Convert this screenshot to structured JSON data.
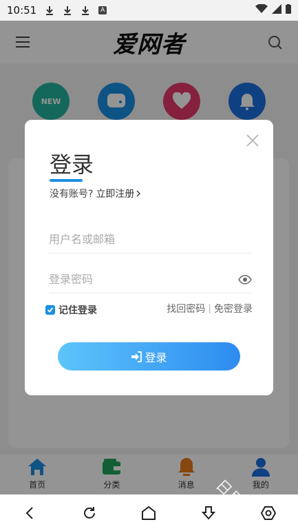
{
  "status": {
    "time": "10:51",
    "a_badge": "A"
  },
  "app": {
    "logo": "爱网者"
  },
  "shortcuts": [
    {
      "label": "NEW",
      "color": "#23b39d"
    },
    {
      "label": "",
      "color": "#1a8fe6"
    },
    {
      "label": "",
      "color": "#e53a6b"
    },
    {
      "label": "",
      "color": "#1a6fe0"
    }
  ],
  "tabs": [
    {
      "label": "首页",
      "color": "#1a8fe6"
    },
    {
      "label": "分类",
      "color": "#21a45c"
    },
    {
      "label": "消息",
      "color": "#e87a1c"
    },
    {
      "label": "我的",
      "color": "#1a6fe0"
    }
  ],
  "modal": {
    "title": "登录",
    "no_account": "没有账号?",
    "register": "立即注册",
    "username_placeholder": "用户名或邮箱",
    "password_placeholder": "登录密码",
    "remember": "记住登录",
    "forgot": "找回密码",
    "separator": "|",
    "quick_login": "免密登录",
    "login_button": "登录"
  },
  "watermark": "日刷"
}
